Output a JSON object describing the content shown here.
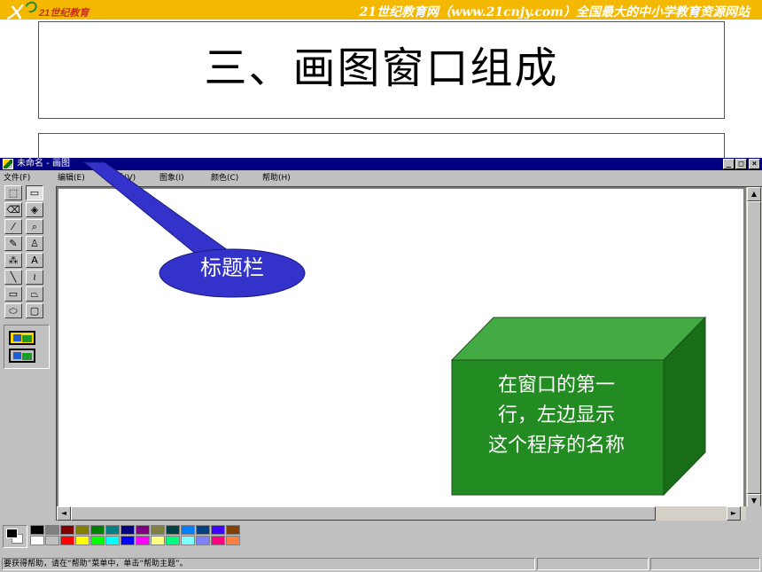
{
  "banner": {
    "logo_text": "21世纪教育",
    "site_text": "21世纪教育网（www.21cnjy.com）全国最大的中小学教育资源网站"
  },
  "slide": {
    "title": "三、画图窗口组成"
  },
  "window": {
    "title": "未命名 - 画图",
    "controls": {
      "minimize": "_",
      "maximize": "□",
      "close": "×"
    },
    "menus": [
      "文件(F)",
      "编辑(E)",
      "查看(V)",
      "图象(I)",
      "颜色(C)",
      "帮助(H)"
    ],
    "tools": [
      {
        "name": "free-select-icon",
        "glyph": "⬚"
      },
      {
        "name": "rect-select-icon",
        "glyph": "▭"
      },
      {
        "name": "eraser-icon",
        "glyph": "⌫"
      },
      {
        "name": "fill-icon",
        "glyph": "◈"
      },
      {
        "name": "color-picker-icon",
        "glyph": "⁄"
      },
      {
        "name": "magnifier-icon",
        "glyph": "⌕"
      },
      {
        "name": "pencil-icon",
        "glyph": "✎"
      },
      {
        "name": "brush-icon",
        "glyph": "♙"
      },
      {
        "name": "airbrush-icon",
        "glyph": "⁂"
      },
      {
        "name": "text-icon",
        "glyph": "A"
      },
      {
        "name": "line-icon",
        "glyph": "╲"
      },
      {
        "name": "curve-icon",
        "glyph": "≀"
      },
      {
        "name": "rectangle-icon",
        "glyph": "▭"
      },
      {
        "name": "polygon-icon",
        "glyph": "⏢"
      },
      {
        "name": "ellipse-icon",
        "glyph": "⬭"
      },
      {
        "name": "rounded-rect-icon",
        "glyph": "▢"
      }
    ],
    "palette_top": [
      "#000000",
      "#808080",
      "#800000",
      "#808000",
      "#008000",
      "#008080",
      "#000080",
      "#800080",
      "#808040",
      "#004040",
      "#0080ff",
      "#004080",
      "#4000ff",
      "#804000"
    ],
    "palette_bottom": [
      "#ffffff",
      "#c0c0c0",
      "#ff0000",
      "#ffff00",
      "#00ff00",
      "#00ffff",
      "#0000ff",
      "#ff00ff",
      "#ffff80",
      "#00ff80",
      "#80ffff",
      "#8080ff",
      "#ff0080",
      "#ff8040"
    ],
    "status": "要获得帮助，请在“帮助”菜单中，单击“帮助主题”。"
  },
  "annotations": {
    "callout": "标题栏",
    "cube_lines": [
      "在窗口的第一",
      "行，左边显示",
      "这个程序的名称"
    ]
  }
}
